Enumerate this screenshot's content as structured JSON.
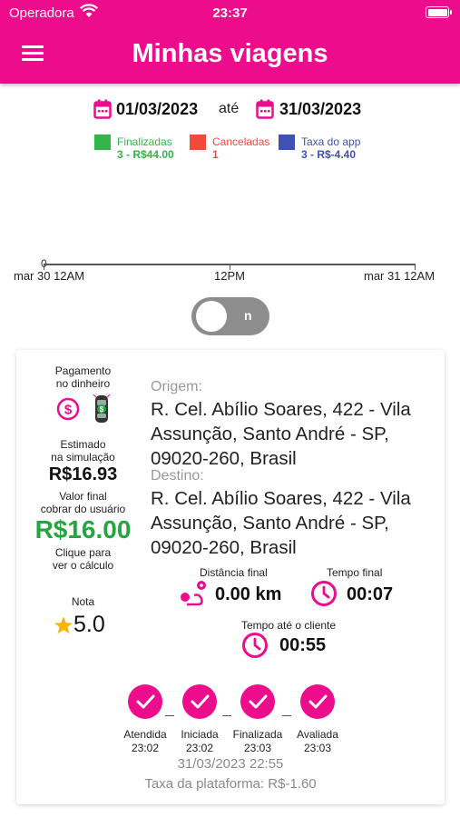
{
  "status_bar": {
    "carrier": "Operadora",
    "time": "23:37"
  },
  "header": {
    "title": "Minhas viagens"
  },
  "date_range": {
    "start": "01/03/2023",
    "separator": "até",
    "end": "31/03/2023"
  },
  "legend": [
    {
      "label": "Finalizadas",
      "value": "3 - R$44.00",
      "color": "#34b44a"
    },
    {
      "label": "Canceladas",
      "value": "1",
      "color": "#f24a3a"
    },
    {
      "label": "Taxa do app",
      "value": "3 - R$-4.40",
      "color": "#3f51b5"
    }
  ],
  "chart": {
    "zero_label": "0",
    "x_labels": [
      "mar 30 12AM",
      "12PM",
      "mar 31 12AM"
    ]
  },
  "toggle": {
    "label": "n"
  },
  "trip": {
    "payment_label": "Pagamento\nno dinheiro",
    "estimated_label": "Estimado\nna simulação",
    "estimated_value": "R$16.93",
    "final_label": "Valor final\ncobrar do usuário",
    "final_value": "R$16.00",
    "calc_link": "Clique para\nver o cálculo",
    "rating_label": "Nota",
    "rating_value": "5.0",
    "origin_label": "Origem:",
    "origin": "R. Cel. Abílio Soares, 422 - Vila Assunção, Santo André - SP, 09020-260, Brasil",
    "destination_label": "Destino:",
    "destination": "R. Cel. Abílio Soares, 422 - Vila Assunção, Santo André - SP, 09020-260, Brasil",
    "distance_label": "Distância final",
    "distance_value": "0.00 km",
    "time_label": "Tempo final",
    "time_value": "00:07",
    "client_time_label": "Tempo até o cliente",
    "client_time_value": "00:55",
    "steps": [
      {
        "label": "Atendida",
        "time": "23:02"
      },
      {
        "label": "Iniciada",
        "time": "23:02"
      },
      {
        "label": "Finalizada",
        "time": "23:03"
      },
      {
        "label": "Avaliada",
        "time": "23:03"
      }
    ],
    "datetime": "31/03/2023   22:55",
    "platform_fee": "Taxa da plataforma: R$-1.60"
  },
  "colors": {
    "accent": "#ec0c8c",
    "success": "#22a63d",
    "star": "#f7b500"
  }
}
